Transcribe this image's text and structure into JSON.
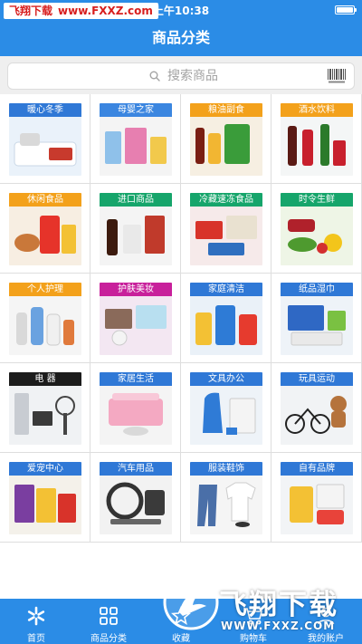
{
  "status_bar": {
    "watermark_brand": "飞翔下载",
    "watermark_url": "www.FXXZ.com",
    "time": "上午10:38"
  },
  "header": {
    "title": "商品分类"
  },
  "search": {
    "placeholder": "搜索商品",
    "icon": "search-icon",
    "scan_icon": "barcode-icon"
  },
  "categories": [
    {
      "label": "暖心冬季",
      "label_color": "#2f78d6",
      "bg": "#eaf2fa"
    },
    {
      "label": "母婴之家",
      "label_color": "#3b86e0",
      "bg": "#f4f4f4"
    },
    {
      "label": "粮油副食",
      "label_color": "#f3a11b",
      "bg": "#f6efe2"
    },
    {
      "label": "酒水饮料",
      "label_color": "#f3a11b",
      "bg": "#f4f6f6"
    },
    {
      "label": "休闲食品",
      "label_color": "#f3a11b",
      "bg": "#f7eee2"
    },
    {
      "label": "进口商品",
      "label_color": "#16a56b",
      "bg": "#f4f4f4"
    },
    {
      "label": "冷藏速冻食品",
      "label_color": "#16a56b",
      "bg": "#f6eaea"
    },
    {
      "label": "时令生鲜",
      "label_color": "#16a56b",
      "bg": "#eef5e6"
    },
    {
      "label": "个人护理",
      "label_color": "#f3a11b",
      "bg": "#f5f5f5"
    },
    {
      "label": "护肤美妆",
      "label_color": "#c8209b",
      "bg": "#f3e7f2"
    },
    {
      "label": "家庭清洁",
      "label_color": "#2f78d6",
      "bg": "#eaf1f8"
    },
    {
      "label": "纸品湿巾",
      "label_color": "#2f78d6",
      "bg": "#eef3f8"
    },
    {
      "label": "电 器",
      "label_color": "#1c1c1c",
      "bg": "#f0f2f4"
    },
    {
      "label": "家居生活",
      "label_color": "#2f78d6",
      "bg": "#f4f4f4"
    },
    {
      "label": "文具办公",
      "label_color": "#2f78d6",
      "bg": "#eef3f8"
    },
    {
      "label": "玩具运动",
      "label_color": "#2f78d6",
      "bg": "#f1f3f5"
    },
    {
      "label": "爱宠中心",
      "label_color": "#2f78d6",
      "bg": "#f4f1ea"
    },
    {
      "label": "汽车用品",
      "label_color": "#2f78d6",
      "bg": "#f2f2f2"
    },
    {
      "label": "服装鞋饰",
      "label_color": "#2f78d6",
      "bg": "#f5f5f5"
    },
    {
      "label": "自有品牌",
      "label_color": "#2f78d6",
      "bg": "#f2f4f6"
    }
  ],
  "tabs": [
    {
      "label": "首页",
      "icon": "walmart-spark-icon"
    },
    {
      "label": "商品分类",
      "icon": "grid-icon",
      "active": true
    },
    {
      "label": "收藏",
      "icon": "star-icon"
    },
    {
      "label": "购物车",
      "icon": "cart-icon"
    },
    {
      "label": "我的账户",
      "icon": "user-icon"
    }
  ],
  "watermark": {
    "title": "飞翔下载",
    "url": "WWW.FXXZ.COM"
  },
  "colors": {
    "brand_blue": "#2b8ce6",
    "grid_line": "#dedede",
    "search_bg": "#efefef"
  }
}
